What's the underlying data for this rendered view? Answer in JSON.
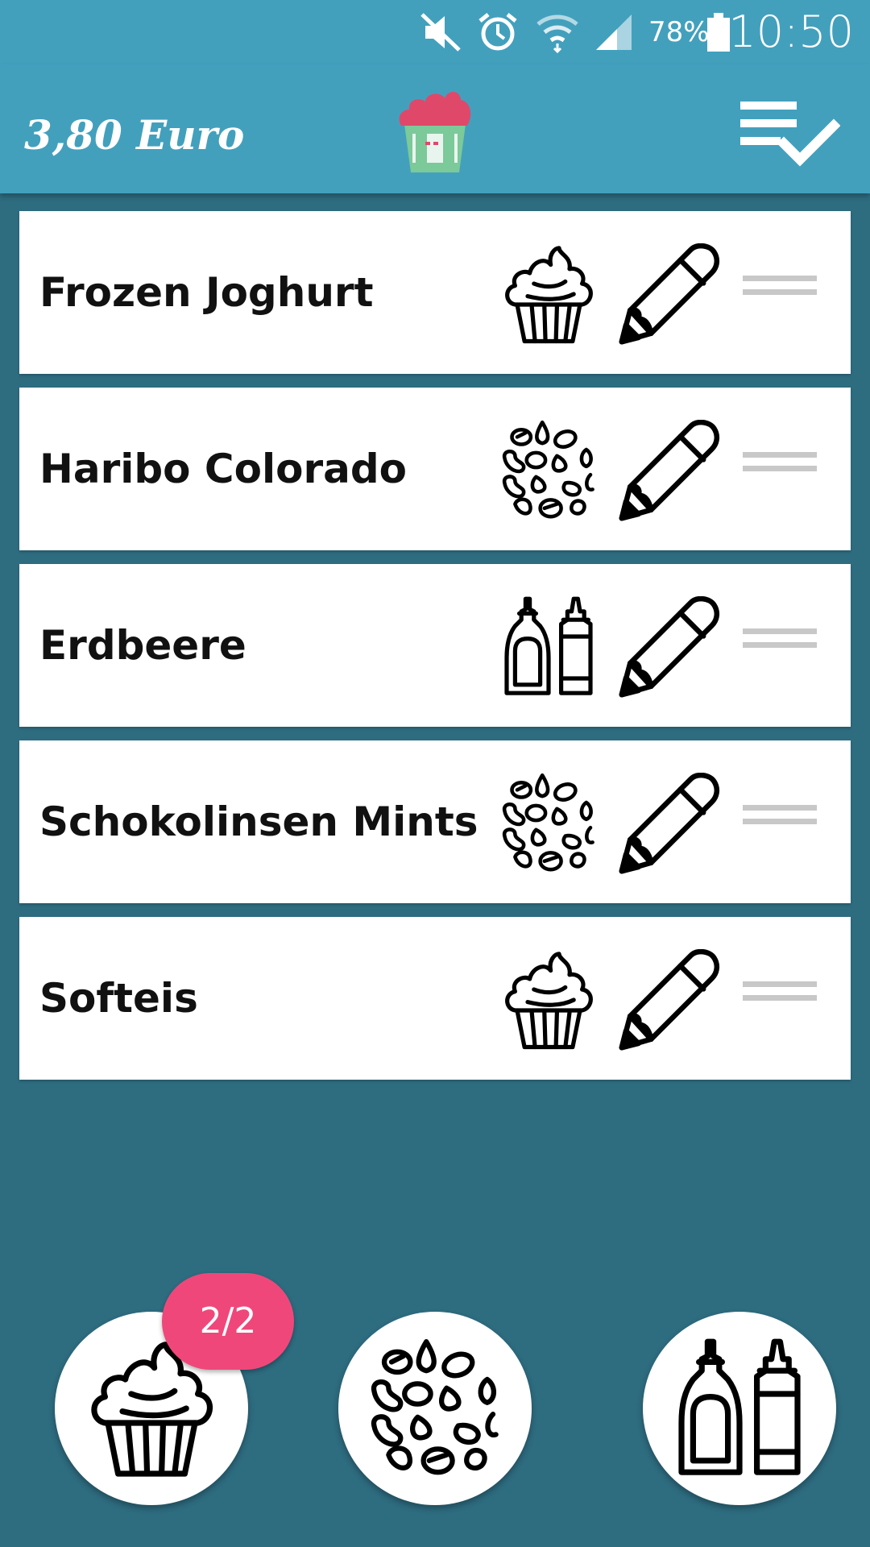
{
  "status_bar": {
    "battery_percent": "78%",
    "time": "10:50",
    "icons": [
      "mute-icon",
      "alarm-icon",
      "wifi-icon",
      "signal-icon",
      "battery-icon"
    ]
  },
  "app_bar": {
    "price": "3,80 Euro",
    "logo": "frozen-yogurt-cup-logo",
    "action_icon": "checklist-icon"
  },
  "items": [
    {
      "name": "Frozen Joghurt",
      "type_icon": "cupcake-icon"
    },
    {
      "name": "Haribo Colorado",
      "type_icon": "toppings-icon"
    },
    {
      "name": "Erdbeere",
      "type_icon": "sauce-bottles-icon"
    },
    {
      "name": "Schokolinsen Mints",
      "type_icon": "toppings-icon"
    },
    {
      "name": "Softeis",
      "type_icon": "cupcake-icon"
    }
  ],
  "bottom_buttons": [
    {
      "icon": "cupcake-icon",
      "badge": "2/2"
    },
    {
      "icon": "toppings-icon"
    },
    {
      "icon": "sauce-bottles-icon"
    }
  ],
  "colors": {
    "app_bar": "#43a0bd",
    "background": "#2e6c80",
    "badge": "#f0477a"
  }
}
